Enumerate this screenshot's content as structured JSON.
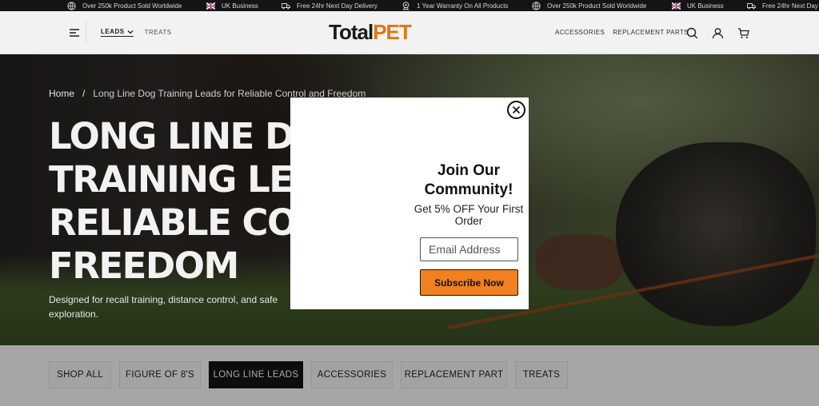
{
  "announcement_bar": {
    "items": [
      {
        "icon": "globe-icon",
        "text": "Over 250k Product Sold Worldwide"
      },
      {
        "icon": "uk-flag-icon",
        "text": "UK Business"
      },
      {
        "icon": "delivery-truck-icon",
        "text": "Free 24hr Next Day Delivery"
      },
      {
        "icon": "warranty-badge-icon",
        "text": "1 Year Warranty On All Products"
      },
      {
        "icon": "globe-icon",
        "text": "Over 250k Product Sold Worldwide"
      },
      {
        "icon": "uk-flag-icon",
        "text": "UK Business"
      },
      {
        "icon": "delivery-truck-icon",
        "text": "Free 24hr Next Day Delivery"
      }
    ]
  },
  "header": {
    "nav_left": {
      "leads": "LEADS",
      "treats": "TREATS"
    },
    "logo": {
      "part1": "Total",
      "part2": "PET"
    },
    "nav_right": {
      "accessories": "ACCESSORIES",
      "replacement_parts": "REPLACEMENT PARTS"
    }
  },
  "hero": {
    "breadcrumb": {
      "home": "Home",
      "separator": "/",
      "current": "Long Line Dog Training Leads for Reliable Control and Freedom"
    },
    "title_lines": [
      "LONG LINE DOG",
      "TRAINING LEADS",
      "RELIABLE CONTR",
      "FREEDOM"
    ],
    "description": "Designed for recall training, distance control, and safe exploration."
  },
  "categories": [
    {
      "label": "SHOP ALL",
      "active": false
    },
    {
      "label": "FIGURE OF 8'S",
      "active": false
    },
    {
      "label": "LONG LINE LEADS",
      "active": true
    },
    {
      "label": "ACCESSORIES",
      "active": false
    },
    {
      "label": "REPLACEMENT PART",
      "active": false
    },
    {
      "label": "TREATS",
      "active": false
    }
  ],
  "popup": {
    "title": "Join Our Community!",
    "subtitle": "Get 5% OFF Your First Order",
    "email_placeholder": "Email Address",
    "button_label": "Subscribe Now"
  },
  "colors": {
    "brand_orange": "#ef7d13",
    "button_orange": "#f08020",
    "dark": "#141414"
  }
}
